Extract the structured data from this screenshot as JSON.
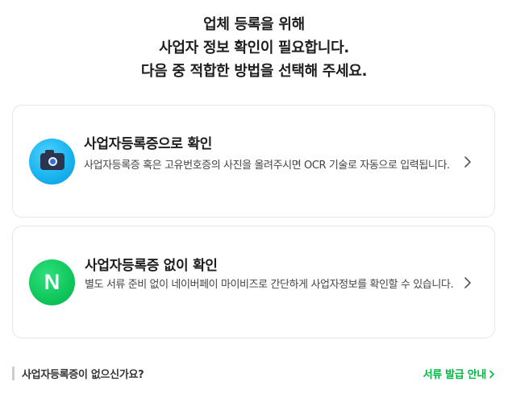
{
  "heading": {
    "line1": "업체 등록을 위해",
    "line2": "사업자 정보 확인이 필요합니다.",
    "line3": "다음 중 적합한 방법을 선택해 주세요."
  },
  "options": [
    {
      "icon": "camera-icon",
      "title": "사업자등록증으로 확인",
      "description": "사업자등록증 혹은 고유번호증의 사진을 올려주시면 OCR 기술로 자동으로 입력됩니다."
    },
    {
      "icon": "naver-n-icon",
      "icon_letter": "N",
      "title": "사업자등록증 없이 확인",
      "description": "별도 서류 준비 없이 네이버페이 마이비즈로 간단하게 사업자정보를 확인할 수 있습니다."
    }
  ],
  "footer": {
    "question": "사업자등록증이 없으신가요?",
    "link_label": "서류 발급 안내"
  },
  "colors": {
    "accent_green": "#00b843",
    "naver_green": "#12c95d",
    "camera_blue": "#1ab4f0",
    "card_border": "#e6e6e6"
  }
}
